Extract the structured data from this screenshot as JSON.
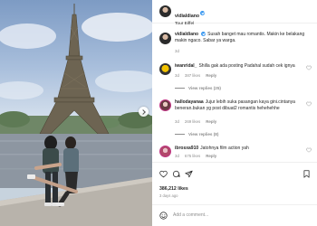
{
  "post": {
    "author": "vidialdiano",
    "location": "Tour Eiffel",
    "caption": "Susah banget mau romantis. Makin ke belakang makin ngaco. Sabar ya warga.",
    "caption_age": "3d"
  },
  "comments": [
    {
      "username": "iwanridal_",
      "text": "Shilla gak ada posting Padahal sudah cek ignya",
      "age": "3d",
      "likes": "387 likes",
      "reply_label": "Reply",
      "view_replies": "View replies (25)"
    },
    {
      "username": "hallodayanaa",
      "text": "Jujur lebih suka pasangan kaya gini.cintanya beneran.bukan yg post dibuat2 romantis hehehehhe",
      "age": "3d",
      "likes": "269 likes",
      "reply_label": "Reply",
      "view_replies": "View replies (8)"
    },
    {
      "username": "ibrosxa910",
      "text": "Jatohnya film action yah",
      "age": "3d",
      "likes": "675 likes",
      "reply_label": "Reply"
    }
  ],
  "engagement": {
    "likes": "386,212 likes",
    "date": "3 days ago"
  },
  "composer": {
    "placeholder": "Add a comment..."
  },
  "icons": {
    "like": "heart-icon",
    "comment": "comment-icon",
    "share": "share-icon",
    "save": "bookmark-icon",
    "emoji": "emoji-icon",
    "verified": "verified-badge-icon",
    "next": "chevron-right-icon"
  },
  "colors": {
    "accent": "#3897f0",
    "muted": "#8e8e8e",
    "text": "#262626",
    "story_ring": "#c13584"
  }
}
